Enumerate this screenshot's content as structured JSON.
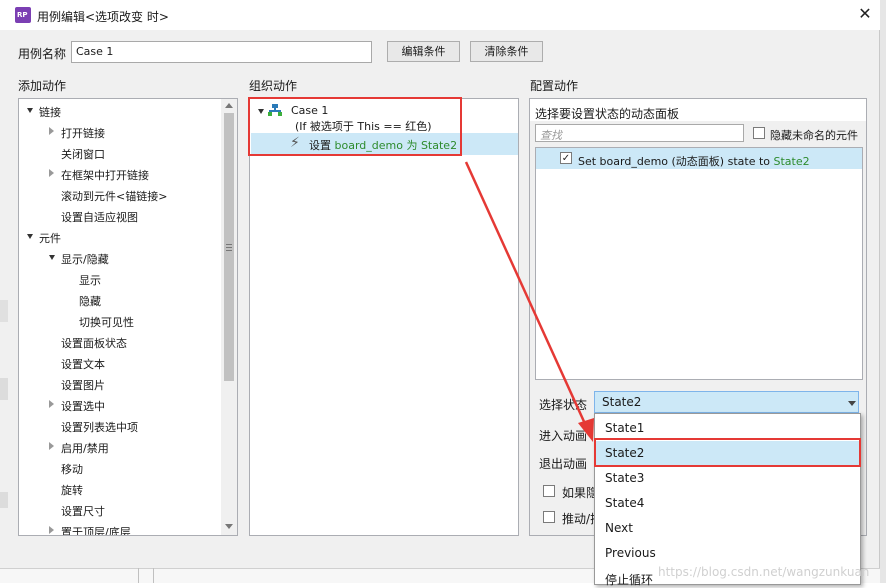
{
  "window": {
    "title": "用例编辑<选项改变 时>",
    "icon_text": "RP",
    "close_glyph": "✕"
  },
  "case_name": {
    "label": "用例名称",
    "value": "Case 1",
    "edit_condition": "编辑条件",
    "clear_condition": "清除条件"
  },
  "sections": {
    "add_action": "添加动作",
    "organize_action": "组织动作",
    "configure_action": "配置动作"
  },
  "action_tree": [
    {
      "label": "链接",
      "level": 0,
      "expand": "down"
    },
    {
      "label": "打开链接",
      "level": 1,
      "expand": "right"
    },
    {
      "label": "关闭窗口",
      "level": 1,
      "expand": ""
    },
    {
      "label": "在框架中打开链接",
      "level": 1,
      "expand": "right"
    },
    {
      "label": "滚动到元件<锚链接>",
      "level": 1,
      "expand": ""
    },
    {
      "label": "设置自适应视图",
      "level": 1,
      "expand": ""
    },
    {
      "label": "元件",
      "level": 0,
      "expand": "down"
    },
    {
      "label": "显示/隐藏",
      "level": 1,
      "expand": "down"
    },
    {
      "label": "显示",
      "level": 2,
      "expand": ""
    },
    {
      "label": "隐藏",
      "level": 2,
      "expand": ""
    },
    {
      "label": "切换可见性",
      "level": 2,
      "expand": ""
    },
    {
      "label": "设置面板状态",
      "level": 1,
      "expand": ""
    },
    {
      "label": "设置文本",
      "level": 1,
      "expand": ""
    },
    {
      "label": "设置图片",
      "level": 1,
      "expand": ""
    },
    {
      "label": "设置选中",
      "level": 1,
      "expand": "right"
    },
    {
      "label": "设置列表选中项",
      "level": 1,
      "expand": ""
    },
    {
      "label": "启用/禁用",
      "level": 1,
      "expand": "right"
    },
    {
      "label": "移动",
      "level": 1,
      "expand": ""
    },
    {
      "label": "旋转",
      "level": 1,
      "expand": ""
    },
    {
      "label": "设置尺寸",
      "level": 1,
      "expand": ""
    },
    {
      "label": "置于顶层/底层",
      "level": 1,
      "expand": "right"
    }
  ],
  "organize": {
    "case_label": "Case 1",
    "condition": "(If 被选项于 This == 红色)",
    "action_prefix": "设置 ",
    "action_target": "board_demo 为 State2"
  },
  "configure": {
    "panel_title": "选择要设置状态的动态面板",
    "search_placeholder": "查找",
    "hide_unnamed": "隐藏未命名的元件",
    "item_text": "Set board_demo (动态面板) state to ",
    "item_state": "State2",
    "select_state_label": "选择状态",
    "select_state_value": "State2",
    "enter_anim_label": "进入动画",
    "exit_anim_label": "退出动画",
    "if_hidden_label": "如果隐",
    "push_label": "推动/拉"
  },
  "state_options": [
    "State1",
    "State2",
    "State3",
    "State4",
    "Next",
    "Previous",
    "停止循环"
  ],
  "selected_state": "State2",
  "watermark": "https://blog.csdn.net/wangzunkuan",
  "colors": {
    "accent_red": "#e53935",
    "selection_blue": "#cce8f7",
    "state_green": "#2d8b2d",
    "brand_purple": "#7b3fb3"
  }
}
